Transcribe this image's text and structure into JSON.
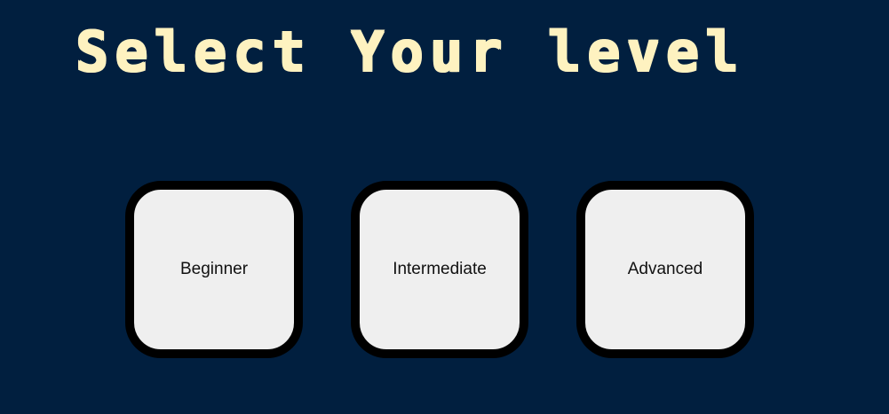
{
  "page": {
    "title": "Select Your level"
  },
  "levels": [
    {
      "label": "Beginner"
    },
    {
      "label": "Intermediate"
    },
    {
      "label": "Advanced"
    }
  ],
  "colors": {
    "background": "#011f3f",
    "title": "#fef2c0",
    "button_fill": "#efefef",
    "button_border": "#000000"
  }
}
